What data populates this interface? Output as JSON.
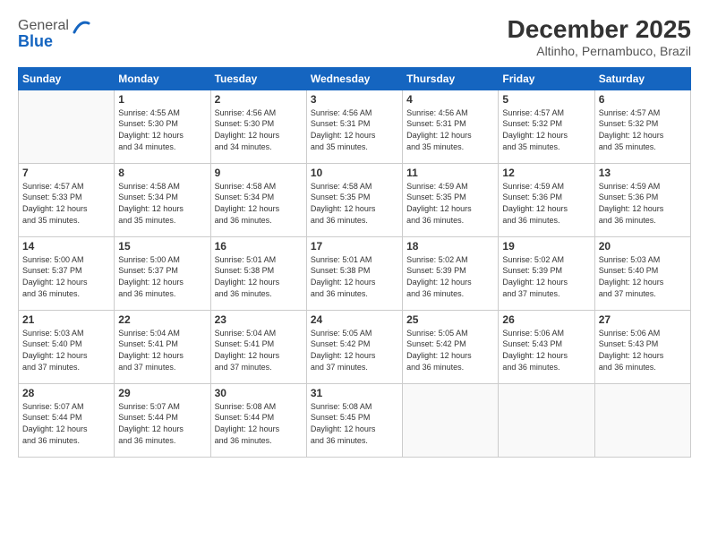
{
  "logo": {
    "general": "General",
    "blue": "Blue"
  },
  "header": {
    "month": "December 2025",
    "location": "Altinho, Pernambuco, Brazil"
  },
  "days_of_week": [
    "Sunday",
    "Monday",
    "Tuesday",
    "Wednesday",
    "Thursday",
    "Friday",
    "Saturday"
  ],
  "weeks": [
    [
      {
        "day": "",
        "info": ""
      },
      {
        "day": "1",
        "info": "Sunrise: 4:55 AM\nSunset: 5:30 PM\nDaylight: 12 hours\nand 34 minutes."
      },
      {
        "day": "2",
        "info": "Sunrise: 4:56 AM\nSunset: 5:30 PM\nDaylight: 12 hours\nand 34 minutes."
      },
      {
        "day": "3",
        "info": "Sunrise: 4:56 AM\nSunset: 5:31 PM\nDaylight: 12 hours\nand 35 minutes."
      },
      {
        "day": "4",
        "info": "Sunrise: 4:56 AM\nSunset: 5:31 PM\nDaylight: 12 hours\nand 35 minutes."
      },
      {
        "day": "5",
        "info": "Sunrise: 4:57 AM\nSunset: 5:32 PM\nDaylight: 12 hours\nand 35 minutes."
      },
      {
        "day": "6",
        "info": "Sunrise: 4:57 AM\nSunset: 5:32 PM\nDaylight: 12 hours\nand 35 minutes."
      }
    ],
    [
      {
        "day": "7",
        "info": "Sunrise: 4:57 AM\nSunset: 5:33 PM\nDaylight: 12 hours\nand 35 minutes."
      },
      {
        "day": "8",
        "info": "Sunrise: 4:58 AM\nSunset: 5:34 PM\nDaylight: 12 hours\nand 35 minutes."
      },
      {
        "day": "9",
        "info": "Sunrise: 4:58 AM\nSunset: 5:34 PM\nDaylight: 12 hours\nand 36 minutes."
      },
      {
        "day": "10",
        "info": "Sunrise: 4:58 AM\nSunset: 5:35 PM\nDaylight: 12 hours\nand 36 minutes."
      },
      {
        "day": "11",
        "info": "Sunrise: 4:59 AM\nSunset: 5:35 PM\nDaylight: 12 hours\nand 36 minutes."
      },
      {
        "day": "12",
        "info": "Sunrise: 4:59 AM\nSunset: 5:36 PM\nDaylight: 12 hours\nand 36 minutes."
      },
      {
        "day": "13",
        "info": "Sunrise: 4:59 AM\nSunset: 5:36 PM\nDaylight: 12 hours\nand 36 minutes."
      }
    ],
    [
      {
        "day": "14",
        "info": "Sunrise: 5:00 AM\nSunset: 5:37 PM\nDaylight: 12 hours\nand 36 minutes."
      },
      {
        "day": "15",
        "info": "Sunrise: 5:00 AM\nSunset: 5:37 PM\nDaylight: 12 hours\nand 36 minutes."
      },
      {
        "day": "16",
        "info": "Sunrise: 5:01 AM\nSunset: 5:38 PM\nDaylight: 12 hours\nand 36 minutes."
      },
      {
        "day": "17",
        "info": "Sunrise: 5:01 AM\nSunset: 5:38 PM\nDaylight: 12 hours\nand 36 minutes."
      },
      {
        "day": "18",
        "info": "Sunrise: 5:02 AM\nSunset: 5:39 PM\nDaylight: 12 hours\nand 36 minutes."
      },
      {
        "day": "19",
        "info": "Sunrise: 5:02 AM\nSunset: 5:39 PM\nDaylight: 12 hours\nand 37 minutes."
      },
      {
        "day": "20",
        "info": "Sunrise: 5:03 AM\nSunset: 5:40 PM\nDaylight: 12 hours\nand 37 minutes."
      }
    ],
    [
      {
        "day": "21",
        "info": "Sunrise: 5:03 AM\nSunset: 5:40 PM\nDaylight: 12 hours\nand 37 minutes."
      },
      {
        "day": "22",
        "info": "Sunrise: 5:04 AM\nSunset: 5:41 PM\nDaylight: 12 hours\nand 37 minutes."
      },
      {
        "day": "23",
        "info": "Sunrise: 5:04 AM\nSunset: 5:41 PM\nDaylight: 12 hours\nand 37 minutes."
      },
      {
        "day": "24",
        "info": "Sunrise: 5:05 AM\nSunset: 5:42 PM\nDaylight: 12 hours\nand 37 minutes."
      },
      {
        "day": "25",
        "info": "Sunrise: 5:05 AM\nSunset: 5:42 PM\nDaylight: 12 hours\nand 36 minutes."
      },
      {
        "day": "26",
        "info": "Sunrise: 5:06 AM\nSunset: 5:43 PM\nDaylight: 12 hours\nand 36 minutes."
      },
      {
        "day": "27",
        "info": "Sunrise: 5:06 AM\nSunset: 5:43 PM\nDaylight: 12 hours\nand 36 minutes."
      }
    ],
    [
      {
        "day": "28",
        "info": "Sunrise: 5:07 AM\nSunset: 5:44 PM\nDaylight: 12 hours\nand 36 minutes."
      },
      {
        "day": "29",
        "info": "Sunrise: 5:07 AM\nSunset: 5:44 PM\nDaylight: 12 hours\nand 36 minutes."
      },
      {
        "day": "30",
        "info": "Sunrise: 5:08 AM\nSunset: 5:44 PM\nDaylight: 12 hours\nand 36 minutes."
      },
      {
        "day": "31",
        "info": "Sunrise: 5:08 AM\nSunset: 5:45 PM\nDaylight: 12 hours\nand 36 minutes."
      },
      {
        "day": "",
        "info": ""
      },
      {
        "day": "",
        "info": ""
      },
      {
        "day": "",
        "info": ""
      }
    ]
  ]
}
